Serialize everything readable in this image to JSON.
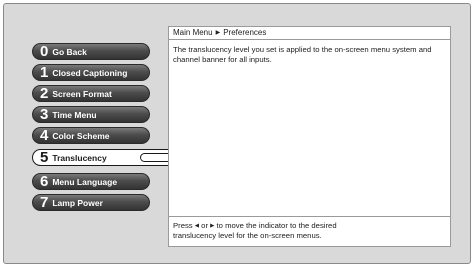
{
  "breadcrumb": {
    "root": "Main Menu",
    "current": "Preferences"
  },
  "menu": {
    "items": [
      {
        "number": "0",
        "label": "Go Back"
      },
      {
        "number": "1",
        "label": "Closed Captioning"
      },
      {
        "number": "2",
        "label": "Screen Format"
      },
      {
        "number": "3",
        "label": "Time Menu"
      },
      {
        "number": "4",
        "label": "Color Scheme"
      },
      {
        "number": "5",
        "label": "Translucency",
        "selected": true
      },
      {
        "number": "6",
        "label": "Menu Language"
      },
      {
        "number": "7",
        "label": "Lamp Power"
      }
    ]
  },
  "translucency": {
    "level_fraction": 0.49
  },
  "description": "The translucency level you set is applied to the on-screen menu system and channel banner for all inputs.",
  "help": {
    "line1_pre": "Press",
    "left_arrow": "◀",
    "line1_or": "or",
    "right_arrow": "▶",
    "line1_post": "to move the indicator to the desired",
    "line2": "translucency level for the on-screen menus."
  },
  "colors": {
    "button_dark": "#3a3a3a",
    "background": "#d9d9d9",
    "panel": "#ffffff"
  },
  "icons": {
    "breadcrumb_separator": "caret-right-icon"
  }
}
